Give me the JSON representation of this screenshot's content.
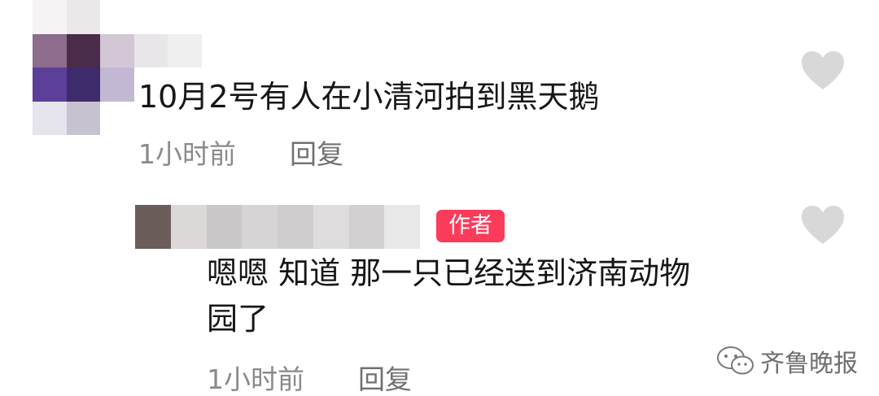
{
  "comments": [
    {
      "text": "10月2号有人在小清河拍到黑天鹅",
      "time": "1小时前",
      "reply_label": "回复",
      "like_icon": "heart-icon",
      "like_color": "#d8d8d8"
    }
  ],
  "reply": {
    "badge": "作者",
    "badge_color": "#fb3b5a",
    "text_line1": "嗯嗯 知道 那一只已经送到济南动物",
    "text_line2": "园了",
    "time": "1小时前",
    "reply_label": "回复",
    "like_icon": "heart-icon"
  },
  "watermark": {
    "icon": "wechat-icon",
    "text": "齐鲁晚报"
  }
}
